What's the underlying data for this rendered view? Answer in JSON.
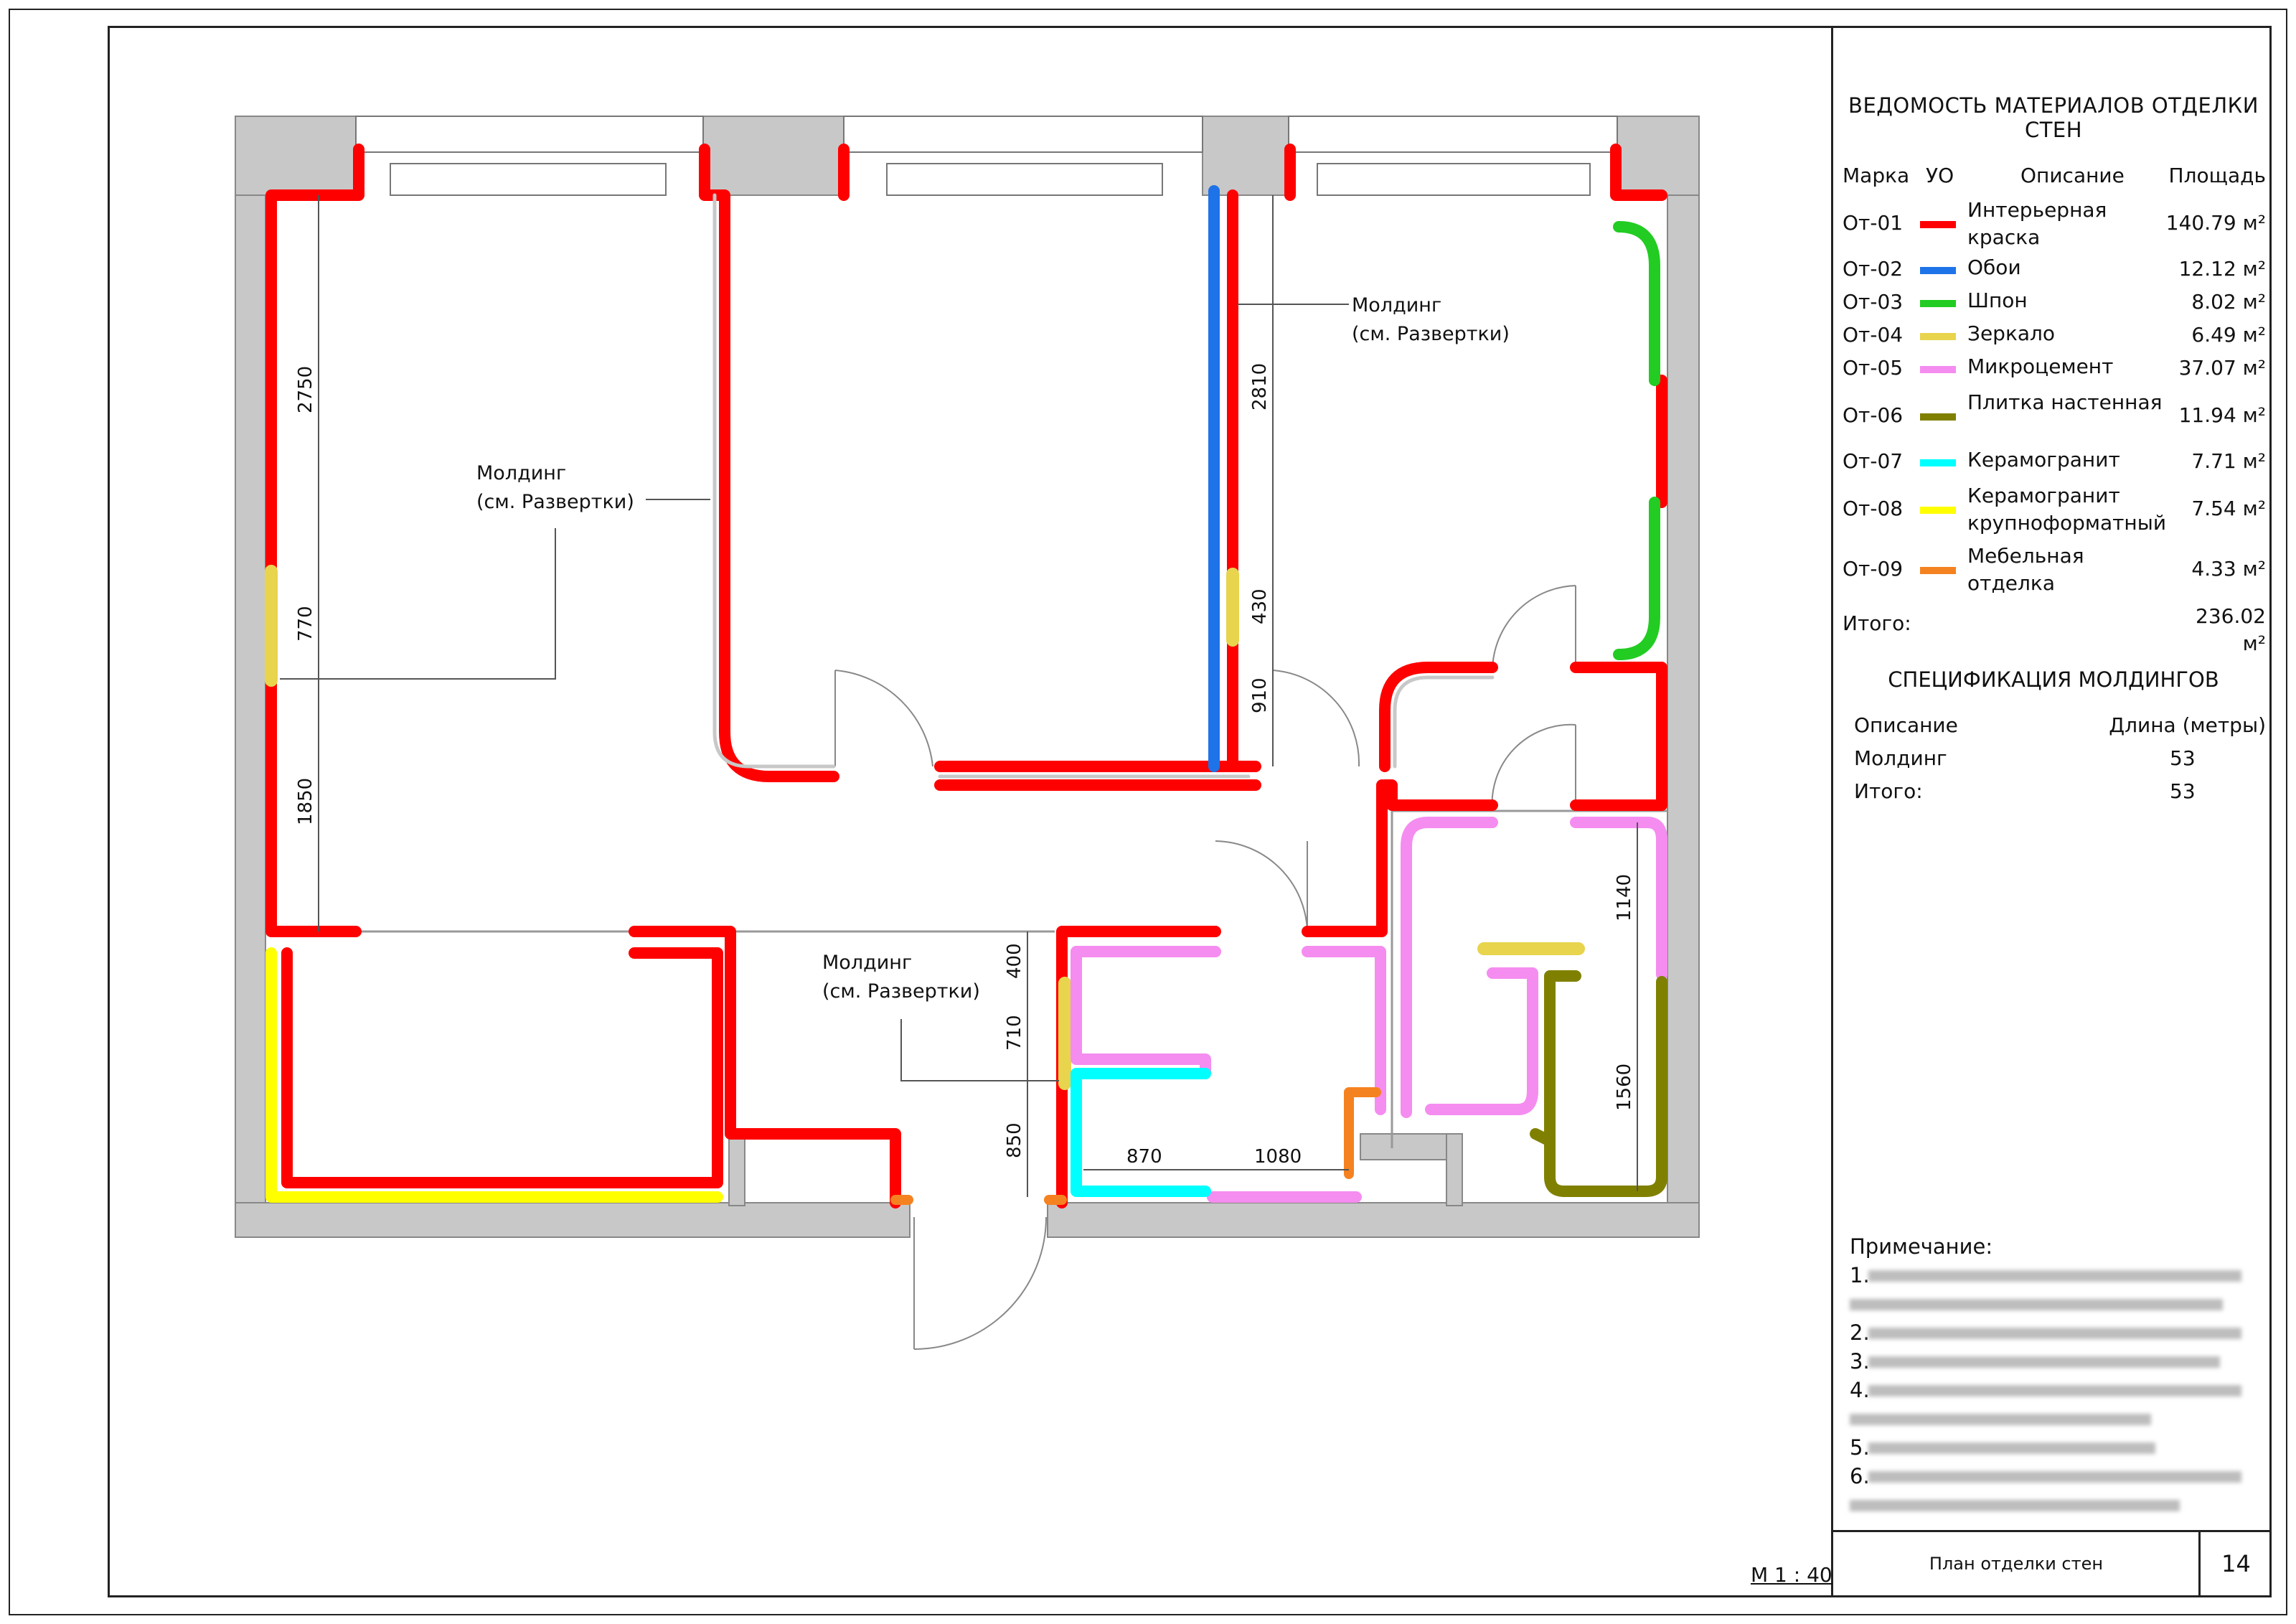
{
  "colors": {
    "red": "#ff0000",
    "blue": "#1e73e8",
    "green": "#22cc22",
    "mirror": "#e8d44d",
    "pink": "#f58cf0",
    "olive": "#808000",
    "cyan": "#00ffff",
    "yellow": "#ffff00",
    "orange": "#f58220",
    "wall": "#c8c8c8"
  },
  "legend": {
    "title": "ВЕДОМОСТЬ МАТЕРИАЛОВ ОТДЕЛКИ СТЕН",
    "headers": {
      "mark": "Марка",
      "uo": "УО",
      "desc": "Описание",
      "area": "Площадь"
    },
    "rows": [
      {
        "mark": "От-01",
        "color": "#ff0000",
        "desc": "Интерьерная краска",
        "area": "140.79 м²"
      },
      {
        "mark": "От-02",
        "color": "#1e73e8",
        "desc": "Обои",
        "area": "12.12 м²"
      },
      {
        "mark": "От-03",
        "color": "#22cc22",
        "desc": "Шпон",
        "area": "8.02 м²"
      },
      {
        "mark": "От-04",
        "color": "#e8d44d",
        "desc": "Зеркало",
        "area": "6.49 м²"
      },
      {
        "mark": "От-05",
        "color": "#f58cf0",
        "desc": "Микроцемент",
        "area": "37.07 м²"
      },
      {
        "mark": "От-06",
        "color": "#808000",
        "desc": "Плитка настенная",
        "area": "11.94 м²"
      },
      {
        "mark": "От-07",
        "color": "#00ffff",
        "desc": "Керамогранит",
        "area": "7.71 м²"
      },
      {
        "mark": "От-08",
        "color": "#ffff00",
        "desc": "Керамогранит крупноформатный",
        "area": "7.54 м²"
      },
      {
        "mark": "От-09",
        "color": "#f58220",
        "desc": "Мебельная отделка",
        "area": "4.33 м²"
      }
    ],
    "total_label": "Итого:",
    "total_value": "236.02 м²"
  },
  "spec": {
    "title": "СПЕЦИФИКАЦИЯ МОЛДИНГОВ",
    "headers": {
      "desc": "Описание",
      "length": "Длина (метры)"
    },
    "row": {
      "desc": "Молдинг",
      "length": "53"
    },
    "total": {
      "label": "Итого:",
      "value": "53"
    }
  },
  "notes": {
    "title": "Примечание:",
    "items": [
      "1.",
      "2.",
      "3.",
      "4.",
      "5.",
      "6."
    ]
  },
  "plan": {
    "callouts": [
      {
        "line1": "Молдинг",
        "line2": "(см. Развертки)"
      },
      {
        "line1": "Молдинг",
        "line2": "(см. Развертки)"
      },
      {
        "line1": "Молдинг",
        "line2": "(см. Развертки)"
      }
    ],
    "dims": [
      "2750",
      "770",
      "1850",
      "2810",
      "430",
      "910",
      "400",
      "710",
      "850",
      "870",
      "1080",
      "1140",
      "1560"
    ]
  },
  "titleblock": {
    "scale": "М 1 : 40",
    "title": "План отделки стен",
    "sheet": "14"
  }
}
